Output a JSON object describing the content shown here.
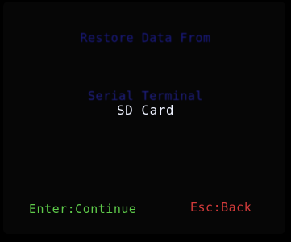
{
  "screen": {
    "title": "Restore Data From",
    "menu": {
      "items": [
        {
          "label": "Serial Terminal"
        },
        {
          "label": "SD Card"
        }
      ],
      "selected_label": "SD Card"
    },
    "footer": {
      "continue_hint": "Enter:Continue",
      "back_hint": "Esc:Back"
    }
  },
  "colors": {
    "background": "#000000",
    "title": "#2020a8",
    "unselected_item": "#2a2ab8",
    "selected_item": "#eef2ff",
    "continue_hint": "#5ecb4a",
    "back_hint": "#d23a3a"
  }
}
